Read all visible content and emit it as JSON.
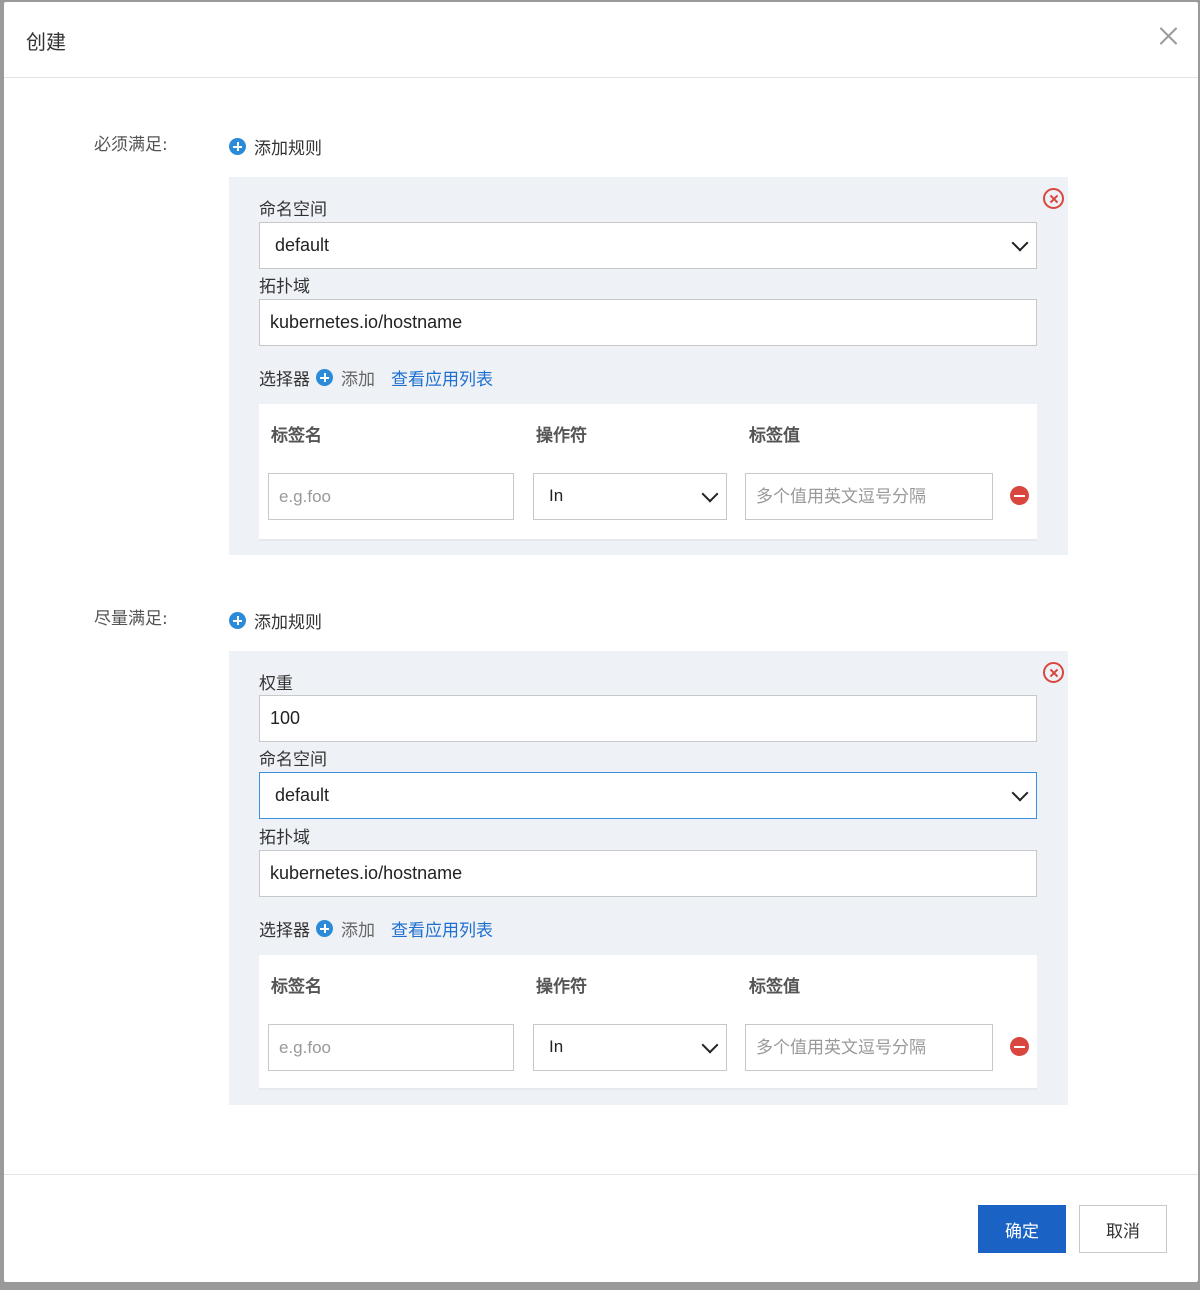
{
  "dialog": {
    "title": "创建",
    "close_icon": "close-icon"
  },
  "required": {
    "label": "必须满足:",
    "add_rule_label": "添加规则",
    "rule": {
      "namespace_label": "命名空间",
      "namespace_value": "default",
      "topology_label": "拓扑域",
      "topology_value": "kubernetes.io/hostname",
      "selector_label": "选择器",
      "selector_add_label": "添加",
      "view_apps_label": "查看应用列表",
      "table": {
        "columns": [
          "标签名",
          "操作符",
          "标签值"
        ],
        "row": {
          "key_placeholder": "e.g.foo",
          "operator": "In",
          "value_placeholder": "多个值用英文逗号分隔"
        }
      }
    }
  },
  "preferred": {
    "label": "尽量满足:",
    "add_rule_label": "添加规则",
    "rule": {
      "weight_label": "权重",
      "weight_value": "100",
      "namespace_label": "命名空间",
      "namespace_value": "default",
      "topology_label": "拓扑域",
      "topology_value": "kubernetes.io/hostname",
      "selector_label": "选择器",
      "selector_add_label": "添加",
      "view_apps_label": "查看应用列表",
      "table": {
        "columns": [
          "标签名",
          "操作符",
          "标签值"
        ],
        "row": {
          "key_placeholder": "e.g.foo",
          "operator": "In",
          "value_placeholder": "多个值用英文逗号分隔"
        }
      }
    }
  },
  "footer": {
    "ok_label": "确定",
    "cancel_label": "取消"
  },
  "colors": {
    "accent": "#1a63c4",
    "add_icon": "#2b8bd8",
    "danger": "#d9463d",
    "link": "#1f6fd0",
    "rule_bg": "#eef1f5"
  }
}
